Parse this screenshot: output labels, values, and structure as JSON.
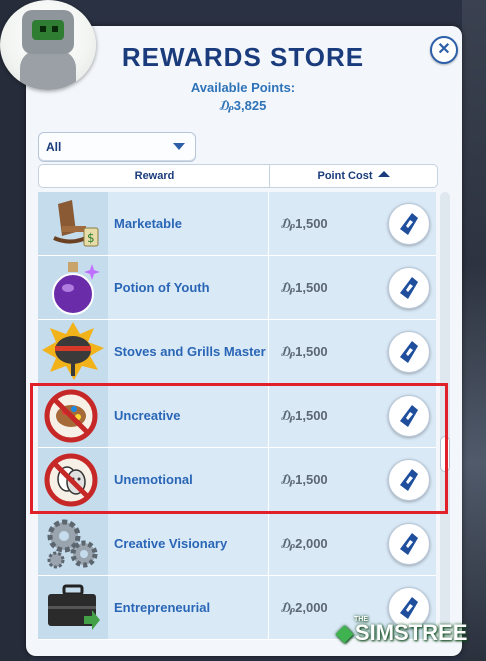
{
  "store": {
    "title": "Rewards Store",
    "title_display": "REWARDS STORE",
    "points_label": "Available Points:",
    "points_value": "₯3,825",
    "close_glyph": "✕"
  },
  "filter": {
    "selected": "All"
  },
  "columns": {
    "reward": "Reward",
    "cost": "Point Cost"
  },
  "rewards": [
    {
      "name": "Marketable",
      "cost": "₯1,500",
      "icon": "rocking-chair-money-icon"
    },
    {
      "name": "Potion of Youth",
      "cost": "₯1,500",
      "icon": "potion-icon"
    },
    {
      "name": "Stoves and Grills Master",
      "cost": "₯1,500",
      "icon": "grill-icon"
    },
    {
      "name": "Uncreative",
      "cost": "₯1,500",
      "icon": "no-paint-palette-icon"
    },
    {
      "name": "Unemotional",
      "cost": "₯1,500",
      "icon": "no-theater-masks-icon"
    },
    {
      "name": "Creative Visionary",
      "cost": "₯2,000",
      "icon": "gears-icon"
    },
    {
      "name": "Entrepreneurial",
      "cost": "₯2,000",
      "icon": "briefcase-icon"
    }
  ],
  "scroll_position": 0.55,
  "watermark": {
    "the": "THE",
    "text": "SIMSTREE"
  },
  "colors": {
    "title": "#1a3b7c",
    "accent": "#2a66b6",
    "highlight": "#e0212a",
    "row_bg": "#d9e9f6"
  }
}
